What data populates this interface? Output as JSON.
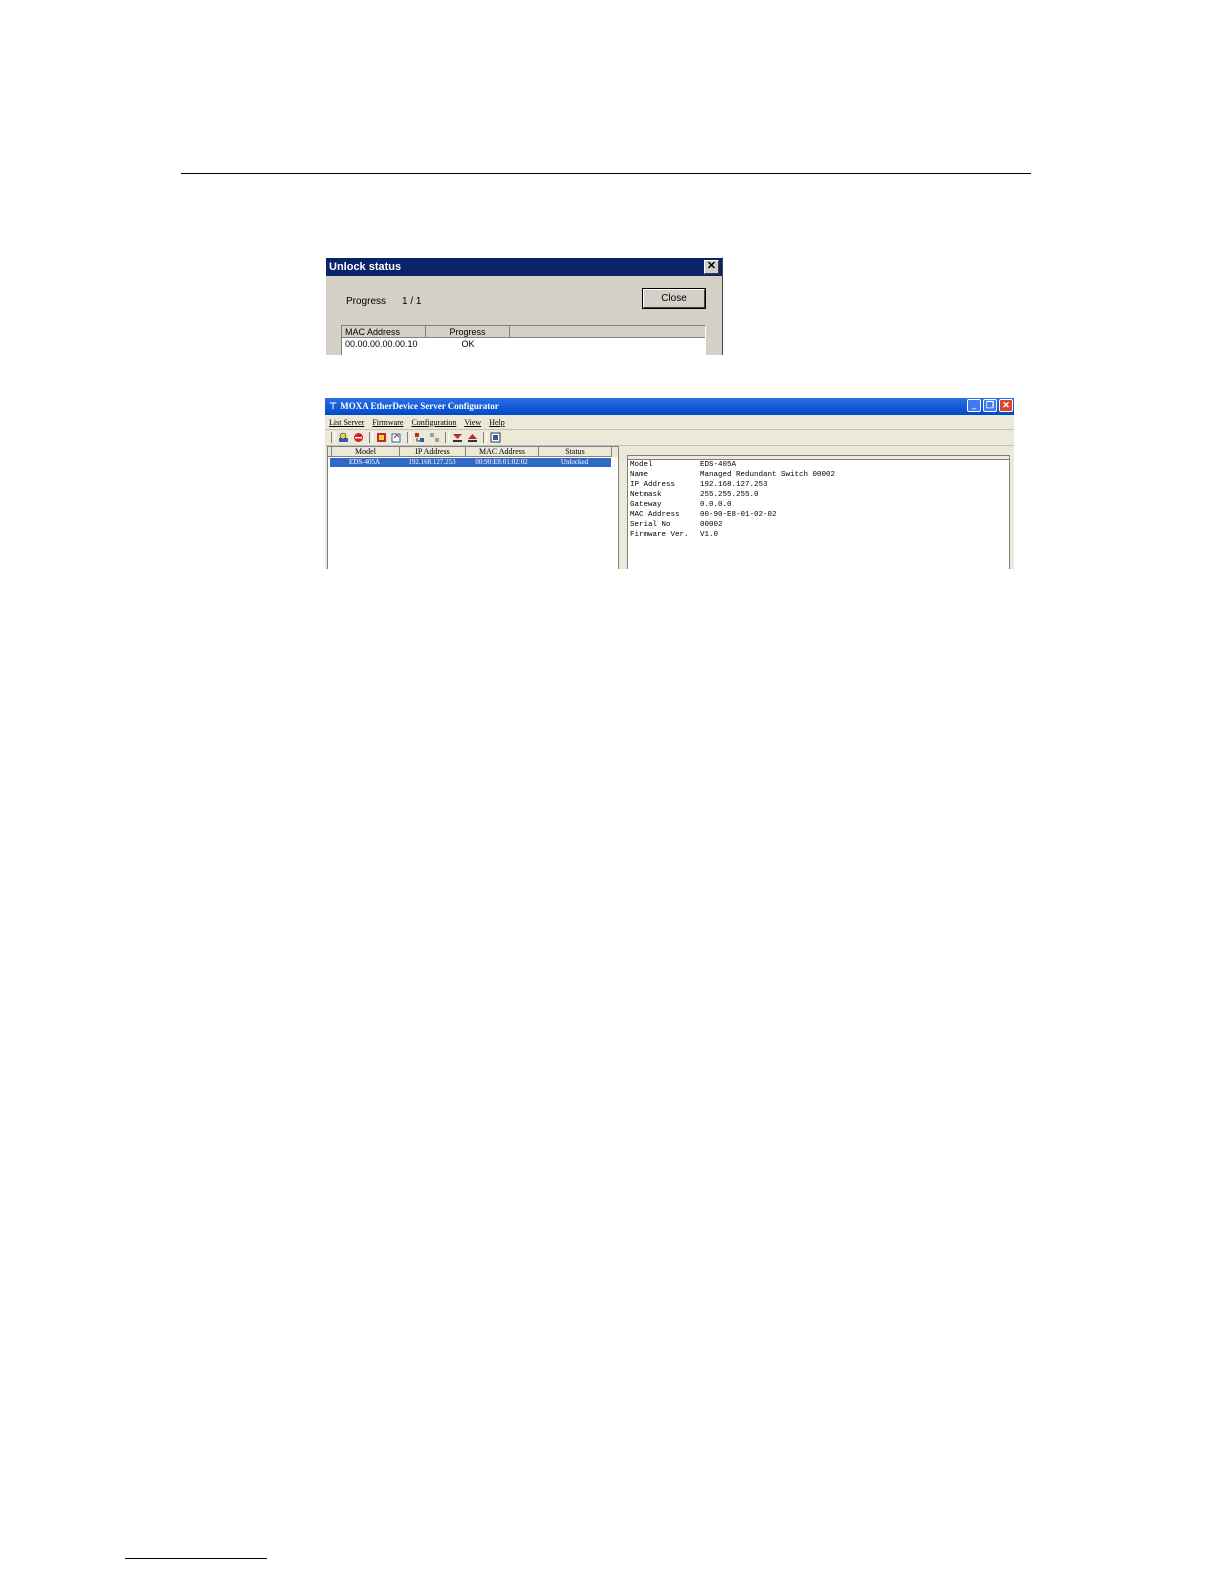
{
  "dialog": {
    "title": "Unlock status",
    "close_x": "✕",
    "progress_label": "Progress",
    "progress_value": "1 / 1",
    "close_button": "Close",
    "columns": [
      "MAC Address",
      "Progress"
    ],
    "rows": [
      {
        "mac": "00.00.00.00.00.10",
        "progress": "OK"
      }
    ]
  },
  "app": {
    "title": "MOXA EtherDevice Server Configurator",
    "menu": [
      "List Server",
      "Firmware",
      "Configuration",
      "View",
      "Help"
    ],
    "window_buttons": {
      "minimize": "_",
      "restore": "❐",
      "close": "✕"
    },
    "toolbar_icons": [
      "search-server-icon",
      "stop-search-icon",
      "upgrade-firmware-icon",
      "configure-icon",
      "export-icon",
      "import-icon",
      "unlock-icon",
      "lock-icon",
      "about-icon"
    ],
    "list_columns": [
      "Model",
      "IP Address",
      "MAC Address",
      "Status"
    ],
    "list_rows": [
      {
        "model": "EDS-405A",
        "ip": "192.168.127.253",
        "mac": "00:90:E8:01:02:02",
        "status": "Unlocked"
      }
    ],
    "info": [
      {
        "key": "Model",
        "value": "EDS-405A"
      },
      {
        "key": "Name",
        "value": "Managed Redundant Switch 00002"
      },
      {
        "key": "IP Address",
        "value": "192.168.127.253"
      },
      {
        "key": "Netmask",
        "value": "255.255.255.0"
      },
      {
        "key": "Gateway",
        "value": "0.0.0.0"
      },
      {
        "key": "MAC Address",
        "value": "00-90-E8-01-02-02"
      },
      {
        "key": "Serial No",
        "value": "00002"
      },
      {
        "key": "Firmware Ver.",
        "value": "V1.0"
      }
    ]
  },
  "colors": {
    "dialog_title_bg": "#0a246a",
    "app_title_bg": "#0049c8",
    "selection": "#316ac5"
  }
}
